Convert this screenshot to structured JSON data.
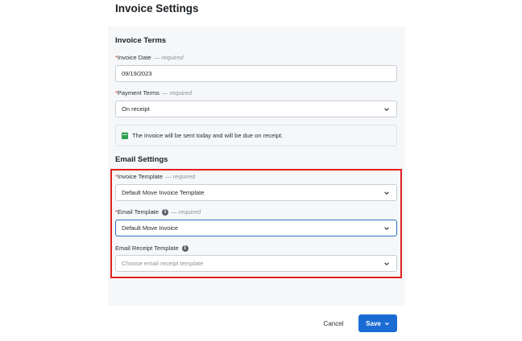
{
  "page": {
    "title": "Invoice Settings"
  },
  "invoice_terms": {
    "title": "Invoice Terms",
    "invoice_date": {
      "label": "Invoice Date",
      "required_note": "— required",
      "value": "09/19/2023"
    },
    "payment_terms": {
      "label": "Payment Terms",
      "required_note": "— required",
      "value": "On receipt"
    },
    "note": "The invoice will be sent today and will be due on receipt."
  },
  "email_settings": {
    "title": "Email Settings",
    "invoice_template": {
      "label": "Invoice Template",
      "required_note": "— required",
      "value": "Default Move Invoice Template"
    },
    "email_template": {
      "label": "Email Template",
      "required_note": "— required",
      "value": "Default Move Invoice"
    },
    "email_receipt_template": {
      "label": "Email Receipt Template",
      "placeholder": "Choose email receipt template"
    }
  },
  "footer": {
    "cancel_label": "Cancel",
    "save_label": "Save"
  },
  "colors": {
    "accent": "#1a6cd4",
    "required": "#d92d20",
    "highlight": "#e02020",
    "calendar_icon": "#2e9e4f"
  },
  "icons": {
    "dropdown": "chevron-down-icon",
    "info": "info-icon",
    "calendar": "calendar-icon"
  }
}
